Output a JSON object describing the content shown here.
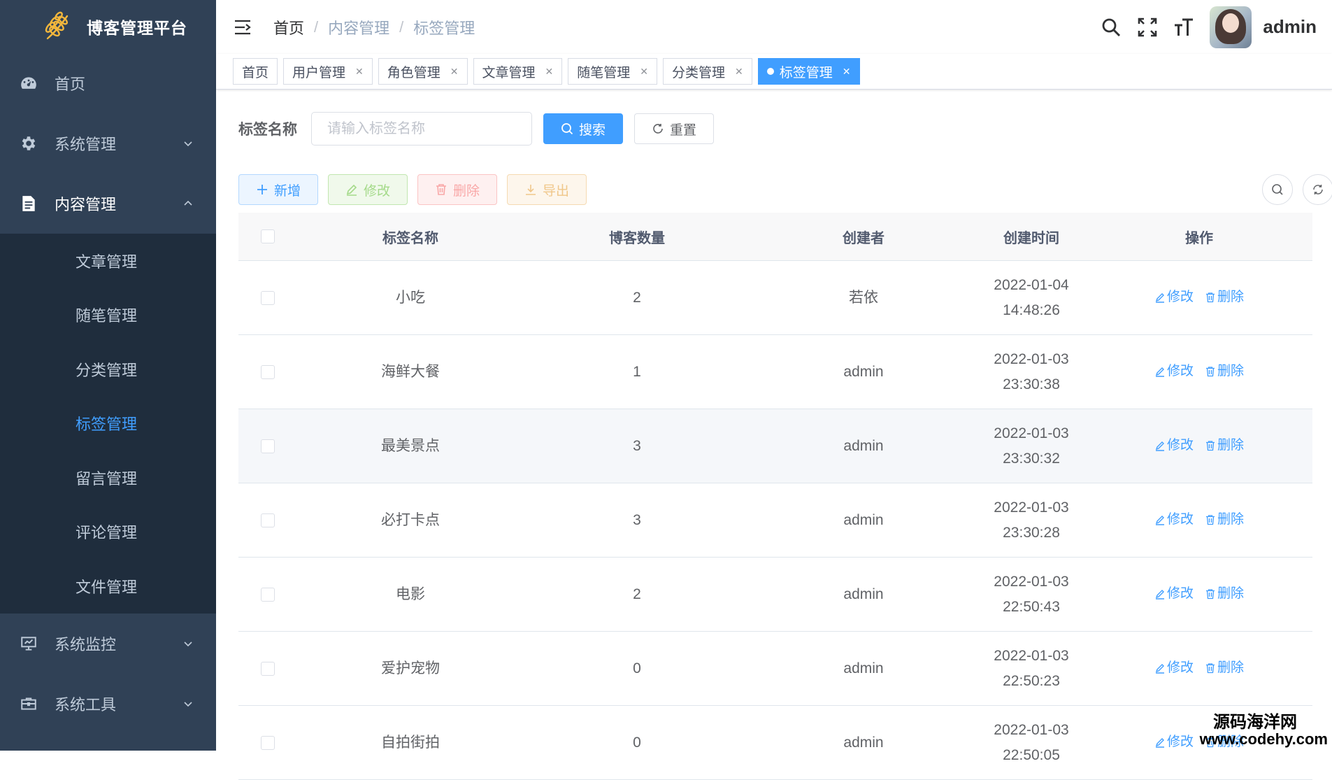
{
  "app": {
    "title": "博客管理平台"
  },
  "sidebar": {
    "items": [
      {
        "label": "首页",
        "icon": "dashboard-icon"
      },
      {
        "label": "系统管理",
        "icon": "gear-icon"
      },
      {
        "label": "内容管理",
        "icon": "document-icon"
      },
      {
        "label": "系统监控",
        "icon": "monitor-icon"
      },
      {
        "label": "系统工具",
        "icon": "toolbox-icon"
      }
    ],
    "submenu": [
      {
        "label": "文章管理"
      },
      {
        "label": "随笔管理"
      },
      {
        "label": "分类管理"
      },
      {
        "label": "标签管理",
        "active": true
      },
      {
        "label": "留言管理"
      },
      {
        "label": "评论管理"
      },
      {
        "label": "文件管理"
      }
    ]
  },
  "navbar": {
    "breadcrumb": [
      "首页",
      "内容管理",
      "标签管理"
    ],
    "username": "admin"
  },
  "tags_view": [
    "首页",
    "用户管理",
    "角色管理",
    "文章管理",
    "随笔管理",
    "分类管理",
    "标签管理"
  ],
  "search": {
    "label": "标签名称",
    "placeholder": "请输入标签名称",
    "search_button": "搜索",
    "reset_button": "重置"
  },
  "toolbar": {
    "add": "新增",
    "edit": "修改",
    "delete": "删除",
    "export": "导出"
  },
  "table": {
    "columns": [
      "标签名称",
      "博客数量",
      "创建者",
      "创建时间",
      "操作"
    ],
    "rows": [
      {
        "name": "小吃",
        "count": "2",
        "creator": "若依",
        "date": "2022-01-04",
        "time": "14:48:26"
      },
      {
        "name": "海鲜大餐",
        "count": "1",
        "creator": "admin",
        "date": "2022-01-03",
        "time": "23:30:38"
      },
      {
        "name": "最美景点",
        "count": "3",
        "creator": "admin",
        "date": "2022-01-03",
        "time": "23:30:32"
      },
      {
        "name": "必打卡点",
        "count": "3",
        "creator": "admin",
        "date": "2022-01-03",
        "time": "23:30:28"
      },
      {
        "name": "电影",
        "count": "2",
        "creator": "admin",
        "date": "2022-01-03",
        "time": "22:50:43"
      },
      {
        "name": "爱护宠物",
        "count": "0",
        "creator": "admin",
        "date": "2022-01-03",
        "time": "22:50:23"
      },
      {
        "name": "自拍街拍",
        "count": "0",
        "creator": "admin",
        "date": "2022-01-03",
        "time": "22:50:05"
      }
    ],
    "row_actions": {
      "edit": "修改",
      "delete": "删除"
    }
  },
  "watermark": {
    "line1": "源码海洋网",
    "line2": "www.codehy.com"
  },
  "colors": {
    "sidebar_bg": "#304156",
    "submenu_bg": "#1f2d3d",
    "primary": "#409eff"
  }
}
